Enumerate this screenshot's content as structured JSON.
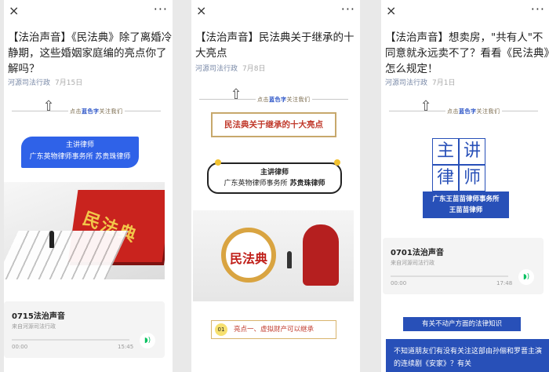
{
  "panels": [
    {
      "close": "×",
      "more": "···",
      "title": "【法治声音】《民法典》除了离婚冷静期，这些婚姻家庭编的亮点你了解吗？",
      "source": "河源司法行政",
      "date": "7月15日",
      "stamp_prefix": "点击",
      "stamp_highlight": "蓝色字",
      "stamp_suffix": "关注我们",
      "speaker_title": "主讲律师",
      "speaker_name": "广东英物律师事务所 苏贵珠律师",
      "book_text": "民法典",
      "audio": {
        "title": "0715法治声音",
        "sub": "来自河源司法行政",
        "start": "00:00",
        "end": "15:45"
      }
    },
    {
      "close": "×",
      "more": "···",
      "title": "【法治声音】民法典关于继承的十大亮点",
      "source": "河源司法行政",
      "date": "7月8日",
      "stamp_prefix": "点击",
      "stamp_highlight": "蓝色字",
      "stamp_suffix": "关注我们",
      "banner": "民法典关于继承的十大亮点",
      "speaker_title": "主讲律师",
      "speaker_name_prefix": "广东英物律师事务所",
      "speaker_name": "苏贵珠律师",
      "magnifier_text": "民法典",
      "point_num": "01",
      "point_text": "亮点一、虚拟财产可以继承"
    },
    {
      "close": "×",
      "more": "···",
      "title": "【法治声音】想卖房，\"共有人\"不同意就永远卖不了？看看《民法典》怎么规定！",
      "source": "河源司法行政",
      "date": "7月1日",
      "stamp_prefix": "点击",
      "stamp_highlight": "蓝色字",
      "stamp_suffix": "关注我们",
      "grid": [
        "主",
        "讲",
        "律",
        "师"
      ],
      "firm": "广东王苗苗律师事务所",
      "lawyer": "王苗苗律师",
      "audio": {
        "title": "0701法治声音",
        "sub": "来自河源司法行政",
        "start": "00:00",
        "end": "17:48"
      },
      "section_tag": "有关不动产方面的法律知识",
      "quote": "不知道朋友们有没有关注这部由孙俪和罗晋主演的连续剧《安家》？有关"
    }
  ]
}
